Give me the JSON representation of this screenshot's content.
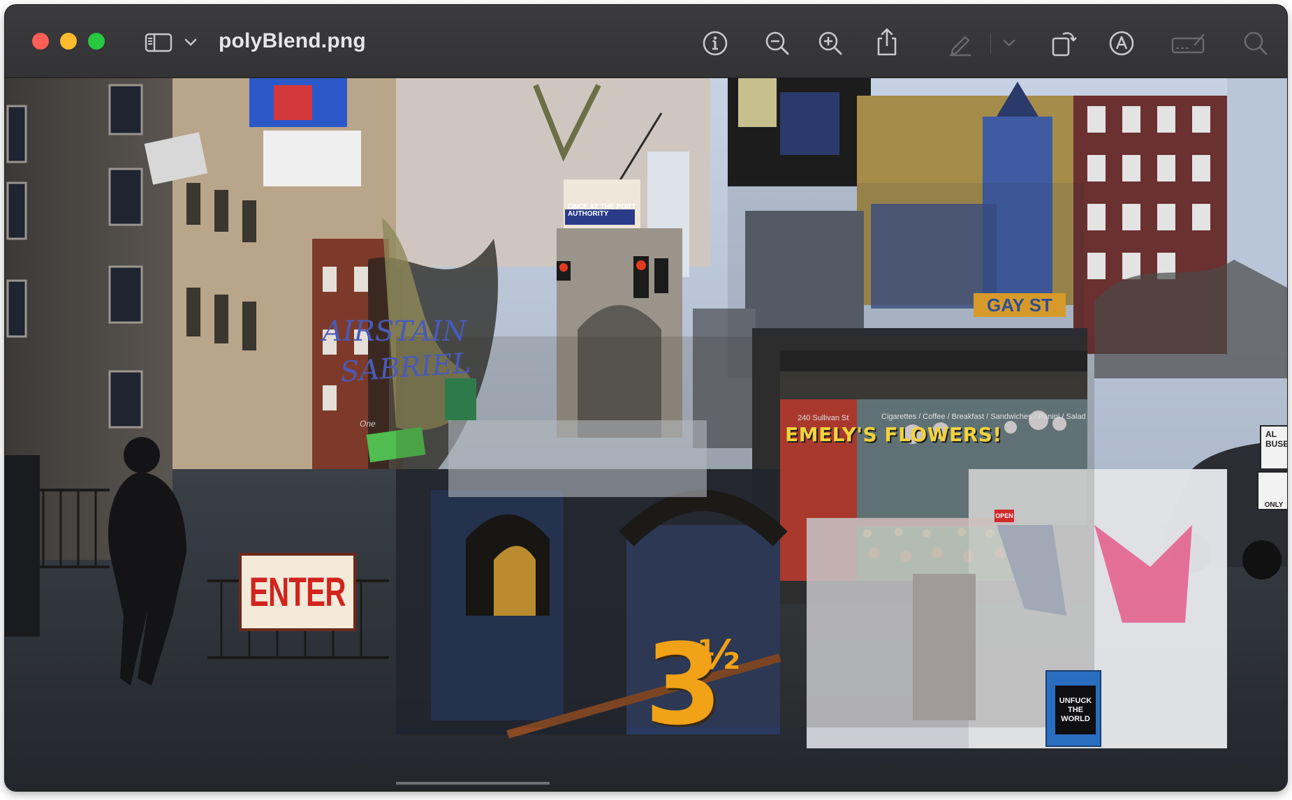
{
  "window": {
    "title": "polyBlend.png"
  },
  "toolbar": {
    "icons": [
      "sidebar-toggle-icon",
      "chevron-down-icon",
      "info-icon",
      "zoom-out-icon",
      "zoom-in-icon",
      "share-icon",
      "highlight-pen-icon",
      "chevron-down-icon",
      "rotate-icon",
      "markup-icon",
      "signature-box-icon",
      "search-icon"
    ]
  },
  "image": {
    "signs": {
      "enter": "ENTER",
      "number": "3",
      "fraction": "½",
      "shop_name": "EMELY'S FLOWERS!",
      "address": "240 Sullivan St",
      "menu": "Cigarettes / Coffee / Breakfast / Sandwiches / Panini / Salad",
      "street": "GAY ST",
      "book": "UNFUCK THE WORLD",
      "open": "OPEN",
      "street_sign_text": "AL BUSE",
      "only_text": "ONLY",
      "graffiti_1": "AIRSTAIN",
      "graffiti_2": "SABRIEL",
      "port_authority": "ONCE AT THE PORT AUTHORITY",
      "one_way": "One"
    }
  },
  "colors": {
    "titlebar": "#38383b",
    "title_text": "#e6e6e6",
    "close": "#ff5f57",
    "minimize": "#febc2e",
    "maximize": "#28c840",
    "icon": "#c9c9cc",
    "icon_disabled": "#6a6a6e"
  }
}
